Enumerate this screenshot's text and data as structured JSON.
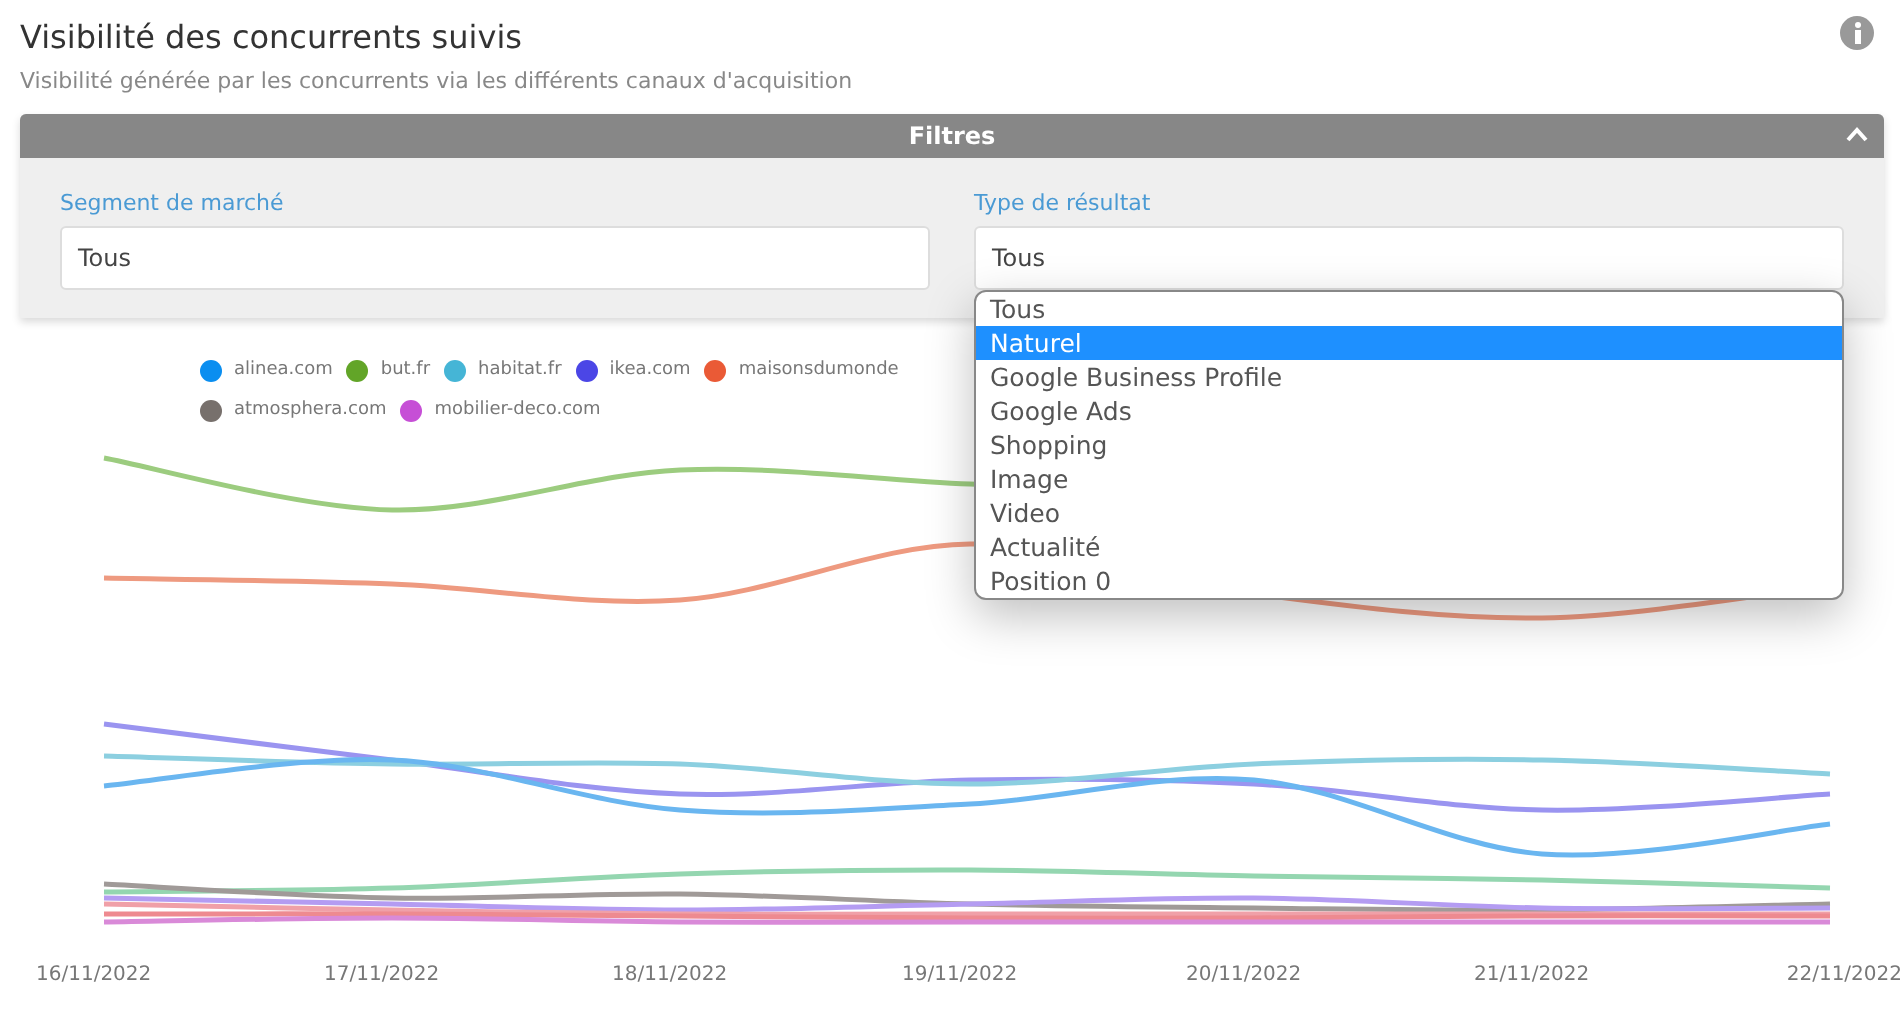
{
  "header": {
    "title": "Visibilité des concurrents suivis",
    "subtitle": "Visibilité générée par les concurrents via les différents canaux d'acquisition"
  },
  "filters": {
    "title": "Filtres",
    "expanded": true,
    "fields": [
      {
        "label": "Segment de marché",
        "value": "Tous"
      },
      {
        "label": "Type de résultat",
        "value": "Tous",
        "expanded": true,
        "options": [
          {
            "label": "Tous",
            "highlighted": false
          },
          {
            "label": "Naturel",
            "highlighted": true
          },
          {
            "label": "Google Business Profile",
            "highlighted": false
          },
          {
            "label": "Google Ads",
            "highlighted": false
          },
          {
            "label": "Shopping",
            "highlighted": false
          },
          {
            "label": "Image",
            "highlighted": false
          },
          {
            "label": "Video",
            "highlighted": false
          },
          {
            "label": "Actualité",
            "highlighted": false
          },
          {
            "label": "Position 0",
            "highlighted": false
          }
        ]
      }
    ]
  },
  "chart": {
    "legend": [
      {
        "label": "alinea.com",
        "color": "#0a8ef0"
      },
      {
        "label": "but.fr",
        "color": "#62a528"
      },
      {
        "label": "habitat.fr",
        "color": "#45b5d6"
      },
      {
        "label": "ikea.com",
        "color": "#4b46e6"
      },
      {
        "label": "maisonsdumonde",
        "color": "#ea5a36"
      },
      {
        "label": "atmosphera.com",
        "color": "#77706c"
      },
      {
        "label": "mobilier-deco.com",
        "color": "#c64fd6"
      }
    ],
    "x_labels": [
      "16/11/2022",
      "17/11/2022",
      "18/11/2022",
      "19/11/2022",
      "20/11/2022",
      "21/11/2022",
      "22/11/2022"
    ]
  }
}
